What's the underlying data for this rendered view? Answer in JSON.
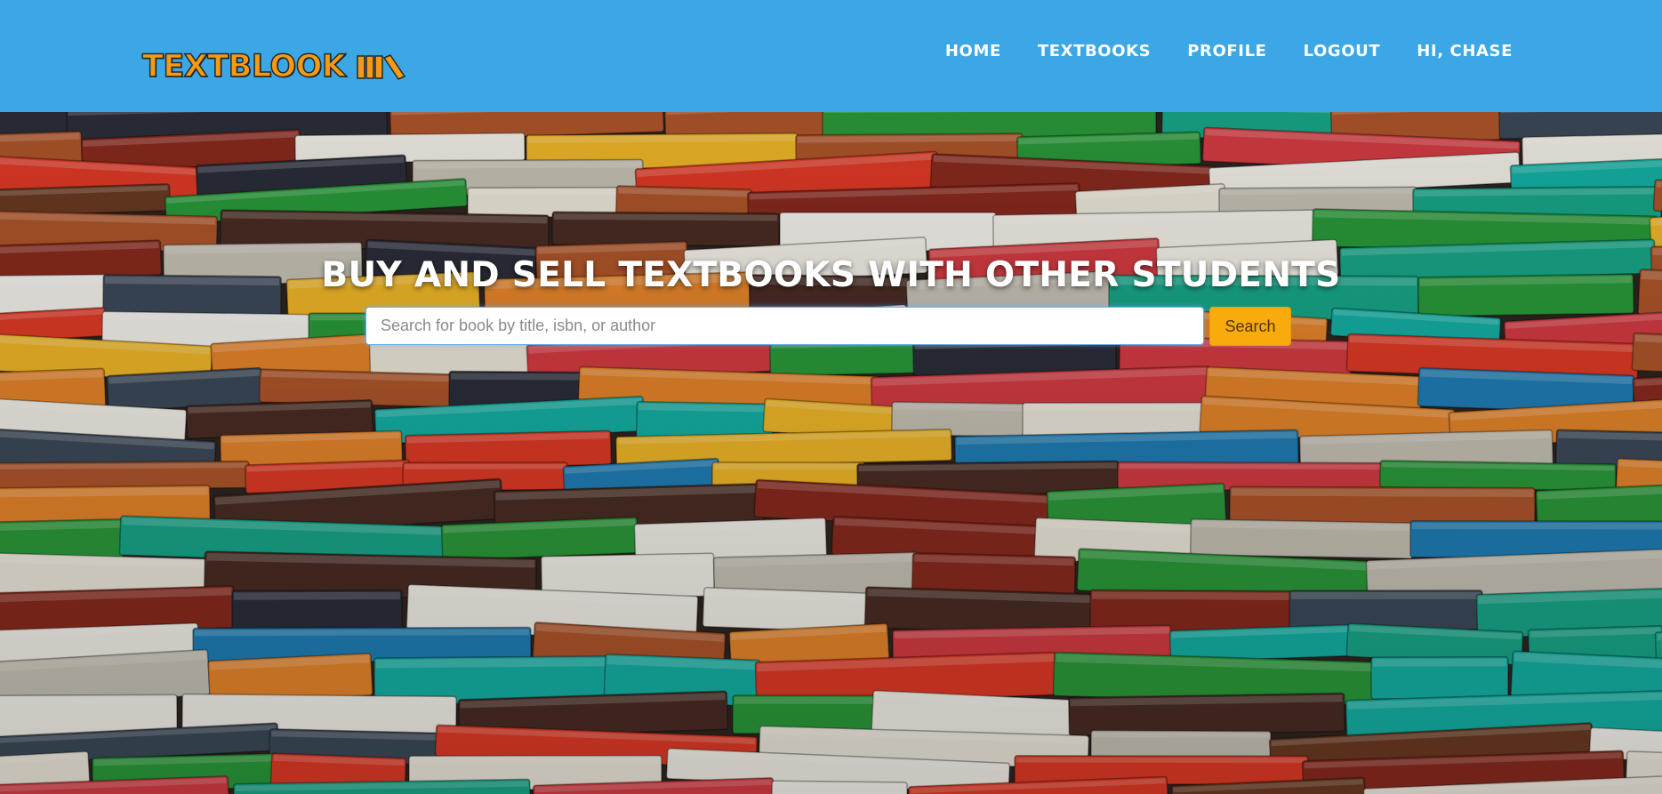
{
  "brand": {
    "name": "TEXTBLOOK",
    "logo_icon": "books-on-shelf-icon",
    "color": "#f59a12"
  },
  "nav": {
    "home": "HOME",
    "textbooks": "TEXTBOOKS",
    "profile": "PROFILE",
    "logout": "LOGOUT",
    "greeting": "HI, CHASE"
  },
  "hero": {
    "headline": "BUY AND SELL TEXTBOOKS WITH OTHER STUDENTS",
    "background": "pile of colorful textbooks photo",
    "search": {
      "placeholder": "Search for book by title, isbn, or author",
      "value": "",
      "button_label": "Search"
    }
  },
  "colors": {
    "navbar": "#3ba7e5",
    "search_button": "#f9ab0d",
    "headline": "#ffffff"
  }
}
